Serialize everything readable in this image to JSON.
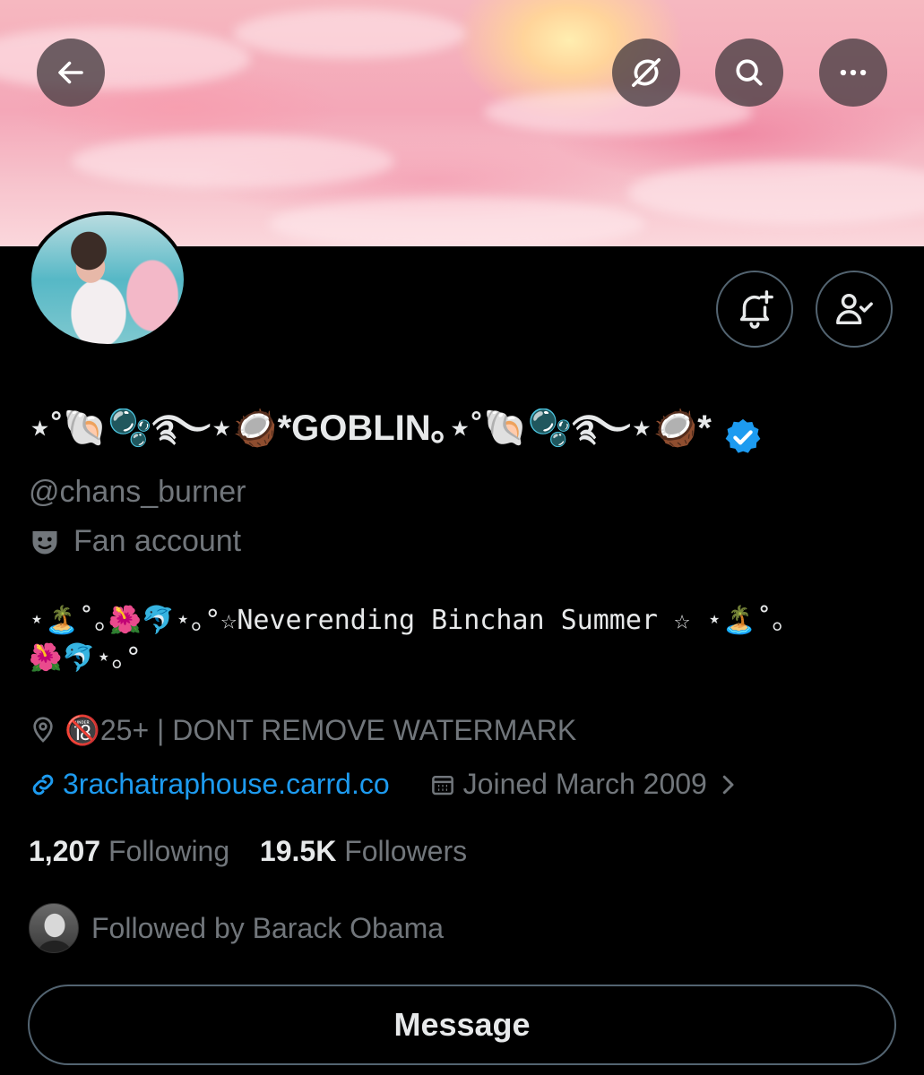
{
  "header": {
    "back_icon": "arrow-left-icon",
    "grok_icon": "grok-icon",
    "search_icon": "search-icon",
    "more_icon": "more-dots-icon"
  },
  "profile": {
    "display_name": "⋆˚🐚🫧࿐⋆🥥*GOBLIN｡⋆˚🐚🫧࿐⋆🥥*",
    "handle": "@chans_burner",
    "category": "Fan account",
    "bio_line1": "⋆🏝️˚｡🌺🐬⋆｡°☆Neverending Binchan Summer ☆ ⋆🏝️˚｡",
    "bio_line2": "🌺🐬⋆｡°",
    "location": "🔞25+ | DONT REMOVE WATERMARK",
    "website": "3rachatraphouse.carrd.co",
    "joined": "Joined March 2009",
    "following_count": "1,207",
    "following_label": "Following",
    "followers_count": "19.5K",
    "followers_label": "Followers",
    "followed_by": "Followed by Barack Obama",
    "message_label": "Message"
  },
  "colors": {
    "background": "#000000",
    "text": "#e7e9ea",
    "muted": "#71767b",
    "link": "#1d9bf0",
    "verified": "#1d9bf0"
  }
}
